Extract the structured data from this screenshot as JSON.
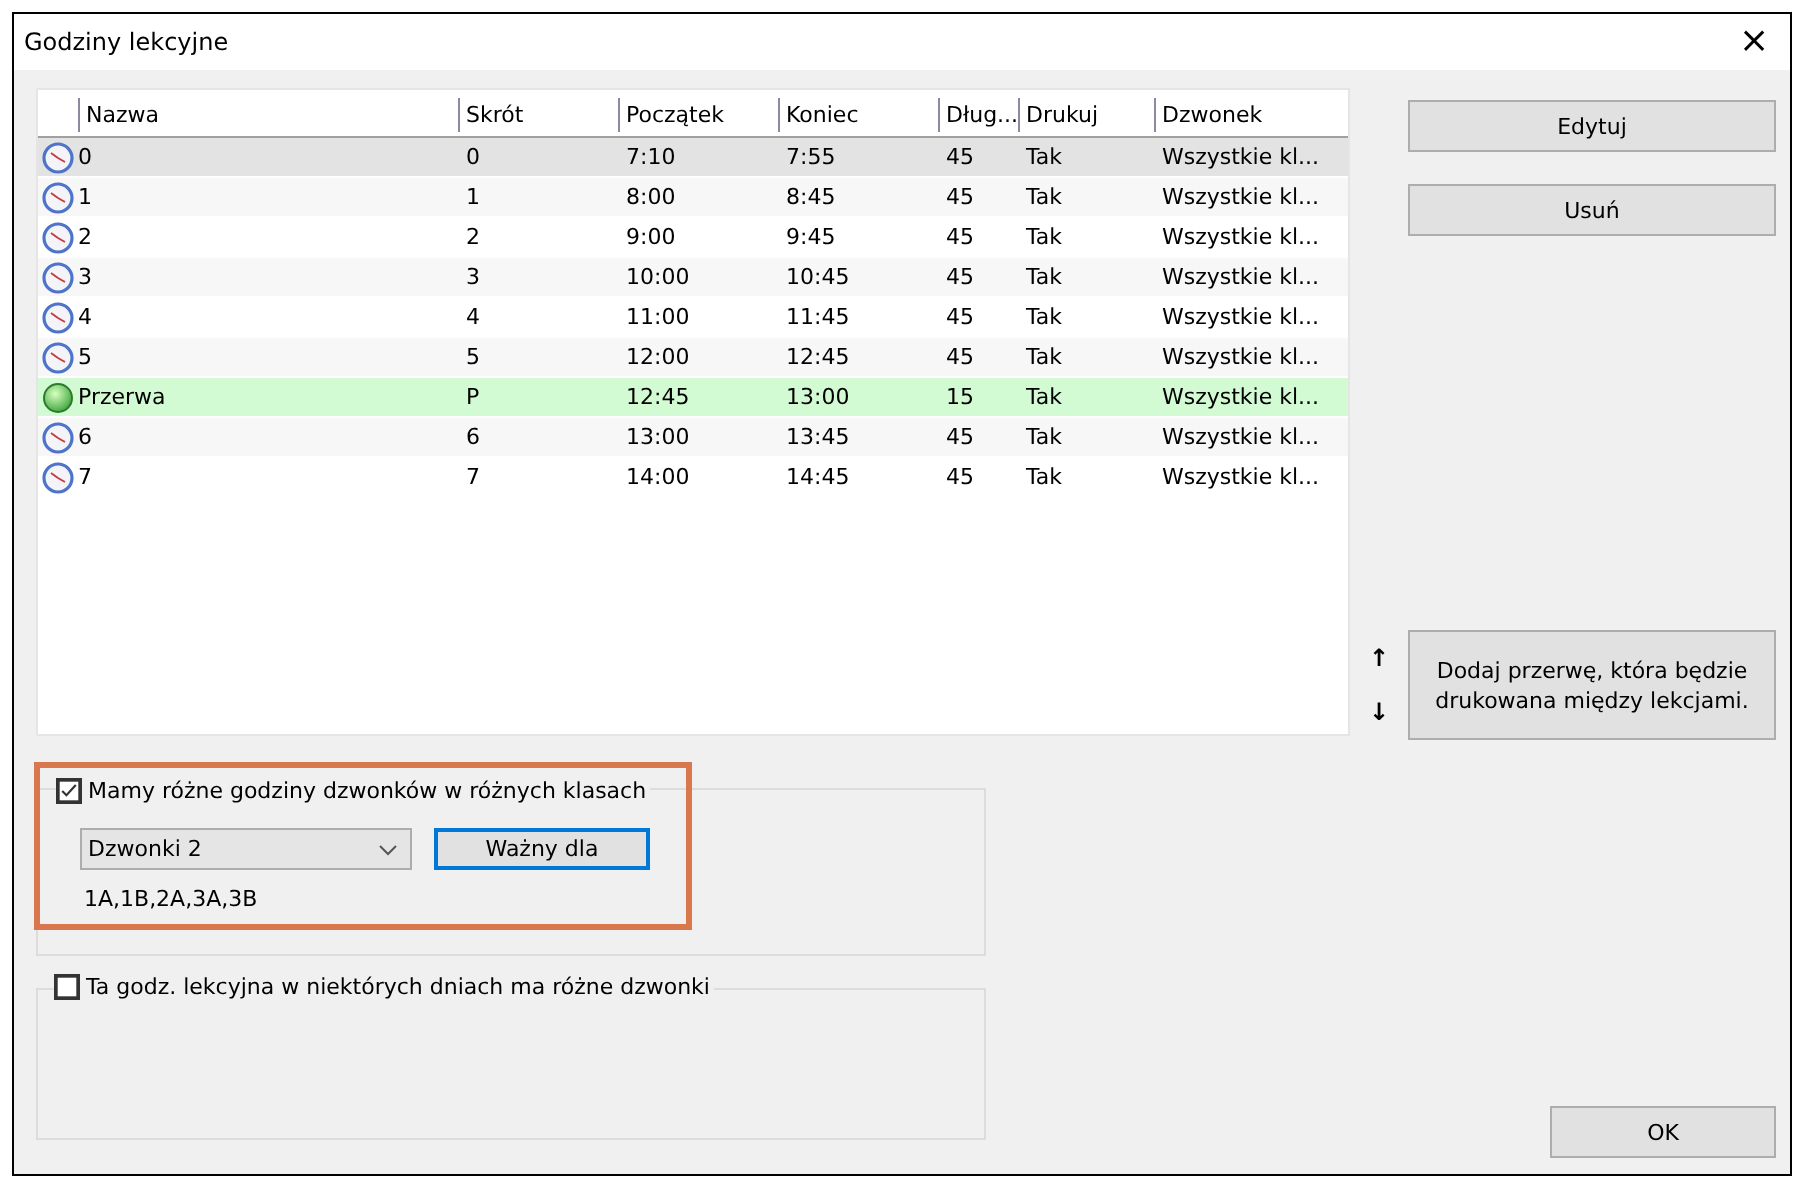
{
  "window": {
    "title": "Godziny lekcyjne",
    "close": "×"
  },
  "table": {
    "columns": [
      "Nazwa",
      "Skrót",
      "Początek",
      "Koniec",
      "Dług...",
      "Drukuj",
      "Dzwonek"
    ],
    "rows": [
      {
        "kind": "lesson",
        "selected": true,
        "cells": [
          "0",
          "0",
          "7:10",
          "7:55",
          "45",
          "Tak",
          "Wszystkie kl..."
        ]
      },
      {
        "kind": "lesson",
        "selected": false,
        "cells": [
          "1",
          "1",
          "8:00",
          "8:45",
          "45",
          "Tak",
          "Wszystkie kl..."
        ]
      },
      {
        "kind": "lesson",
        "selected": false,
        "cells": [
          "2",
          "2",
          "9:00",
          "9:45",
          "45",
          "Tak",
          "Wszystkie kl..."
        ]
      },
      {
        "kind": "lesson",
        "selected": false,
        "cells": [
          "3",
          "3",
          "10:00",
          "10:45",
          "45",
          "Tak",
          "Wszystkie kl..."
        ]
      },
      {
        "kind": "lesson",
        "selected": false,
        "cells": [
          "4",
          "4",
          "11:00",
          "11:45",
          "45",
          "Tak",
          "Wszystkie kl..."
        ]
      },
      {
        "kind": "lesson",
        "selected": false,
        "cells": [
          "5",
          "5",
          "12:00",
          "12:45",
          "45",
          "Tak",
          "Wszystkie kl..."
        ]
      },
      {
        "kind": "break",
        "selected": false,
        "cells": [
          "Przerwa",
          "P",
          "12:45",
          "13:00",
          "15",
          "Tak",
          "Wszystkie kl..."
        ]
      },
      {
        "kind": "lesson",
        "selected": false,
        "cells": [
          "6",
          "6",
          "13:00",
          "13:45",
          "45",
          "Tak",
          "Wszystkie kl..."
        ]
      },
      {
        "kind": "lesson",
        "selected": false,
        "cells": [
          "7",
          "7",
          "14:00",
          "14:45",
          "45",
          "Tak",
          "Wszystkie kl..."
        ]
      }
    ]
  },
  "side_buttons": [
    "Edytuj",
    "Usuń"
  ],
  "move": {
    "up": "↑",
    "down": "↓"
  },
  "add_break_button": "Dodaj przerwę, która będzie drukowana między lekcjami.",
  "class_bells": {
    "checked": true,
    "label": "Mamy różne godziny dzwonków w różnych klasach",
    "dropdown": "Dzwonki 2",
    "button": "Ważny dla",
    "classes": "1A,1B,2A,3A,3B"
  },
  "day_bells": {
    "checked": false,
    "label": "Ta godz. lekcyjna w niektórych dniach ma różne dzwonki"
  },
  "ok_button": "OK"
}
